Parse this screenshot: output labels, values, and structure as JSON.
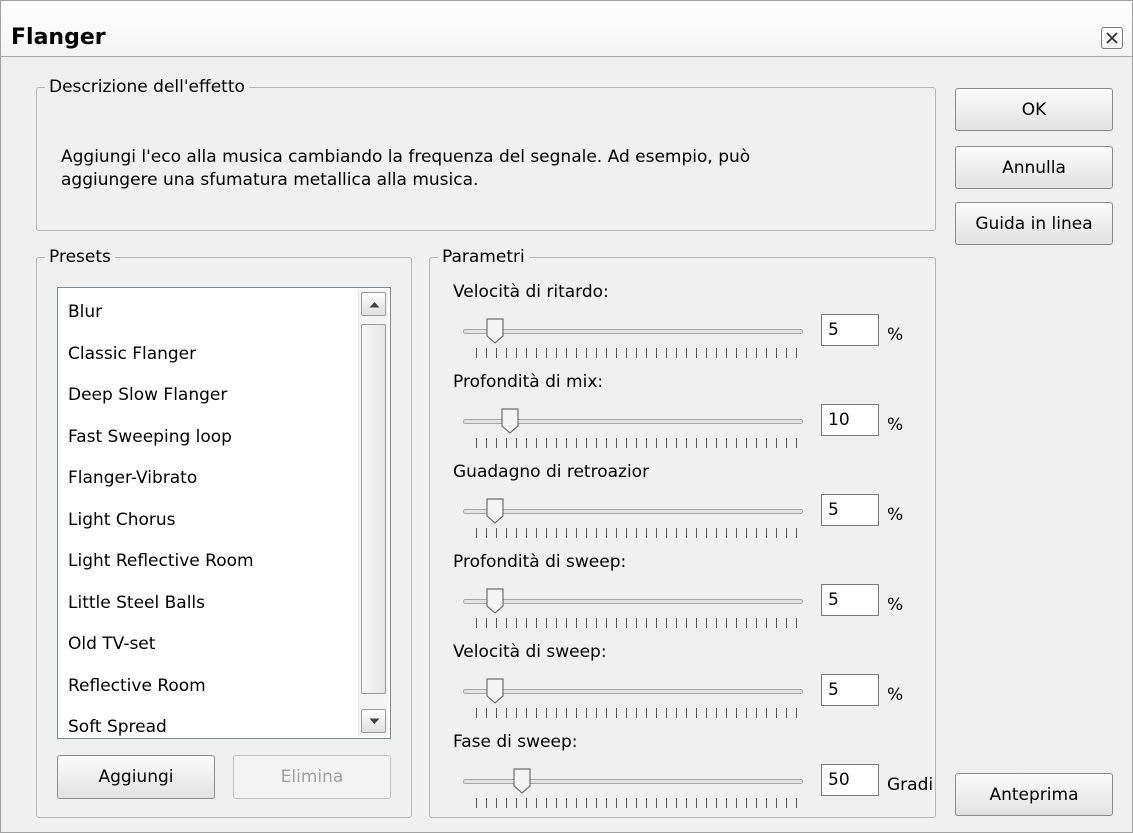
{
  "window": {
    "title": "Flanger",
    "close_icon": "close-icon"
  },
  "description": {
    "legend": "Descrizione dell'effetto",
    "text_line1": "Aggiungi l'eco alla musica cambiando la frequenza del segnale. Ad esempio, può",
    "text_line2": "aggiungere una sfumatura metallica alla musica."
  },
  "buttons": {
    "ok": "OK",
    "cancel": "Annulla",
    "help": "Guida in linea",
    "preview": "Anteprima",
    "add": "Aggiungi",
    "delete": "Elimina"
  },
  "presets": {
    "legend": "Presets",
    "items": [
      "Blur",
      "Classic Flanger",
      "Deep Slow Flanger",
      "Fast Sweeping loop",
      "Flanger-Vibrato",
      "Light Chorus",
      "Light Reflective Room",
      "Little Steel Balls",
      "Old TV-set",
      "Reflective Room",
      "Soft Spread"
    ]
  },
  "parameters": {
    "legend": "Parametri",
    "items": [
      {
        "label": "Velocità di ritardo:",
        "value": "5",
        "unit": "%",
        "level": 0.05
      },
      {
        "label": "Profondità di mix:",
        "value": "10",
        "unit": "%",
        "level": 0.1
      },
      {
        "label": "Guadagno di retroazior",
        "value": "5",
        "unit": "%",
        "level": 0.05
      },
      {
        "label": "Profondità di sweep:",
        "value": "5",
        "unit": "%",
        "level": 0.05
      },
      {
        "label": "Velocità di sweep:",
        "value": "5",
        "unit": "%",
        "level": 0.05
      },
      {
        "label": "Fase di sweep:",
        "value": "50",
        "unit": "Gradi",
        "level": 0.14
      }
    ]
  }
}
